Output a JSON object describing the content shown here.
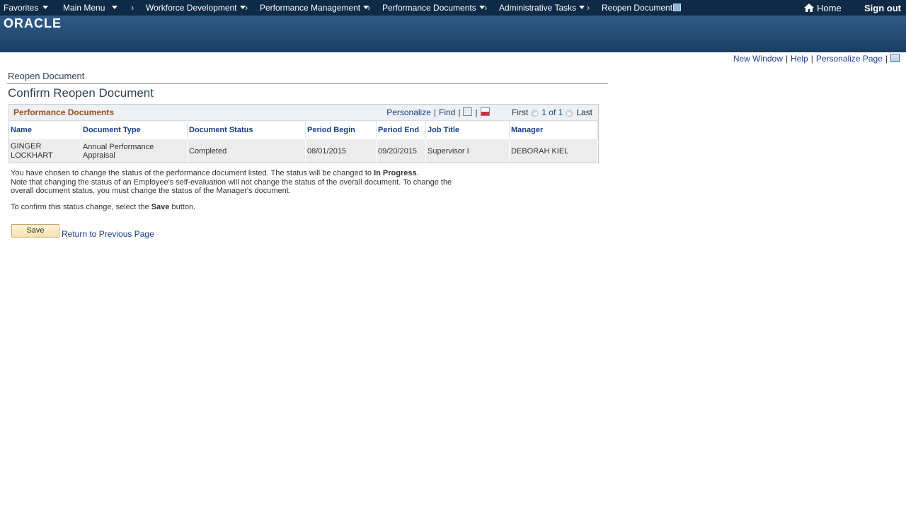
{
  "nav": {
    "items": [
      "Favorites",
      "Main Menu",
      "Workforce Development",
      "Performance Management",
      "Performance Documents",
      "Administrative Tasks",
      "Reopen Document"
    ],
    "home": "Home",
    "signout": "Sign out"
  },
  "brand": {
    "logo": "ORACLE"
  },
  "page_links": {
    "new_window": "New Window",
    "help": "Help",
    "personalize_page": "Personalize Page"
  },
  "breadcrumb": "Reopen Document",
  "page_title": "Confirm Reopen Document",
  "grid": {
    "title": "Performance Documents",
    "personalize": "Personalize",
    "find": "Find",
    "first": "First",
    "page_info": "1 of 1",
    "last": "Last",
    "columns": [
      "Name",
      "Document Type",
      "Document Status",
      "Period Begin",
      "Period End",
      "Job Title",
      "Manager"
    ],
    "rows": [
      {
        "name": "GINGER LOCKHART",
        "document_type": "Annual Performance Appraisal",
        "document_status": "Completed",
        "period_begin": "08/01/2015",
        "period_end": "09/20/2015",
        "job_title": "Supervisor I",
        "manager": "DEBORAH KIEL"
      }
    ]
  },
  "message": {
    "line1_prefix": "You have chosen to change the status of the performance document listed. The status will be changed to ",
    "line1_bold": "In Progress",
    "line1_suffix": ".",
    "line2": "Note that changing the status of an Employee's self-evaluation will not change the status of the overall document. To change the overall document status, you must change the status of the Manager's document.",
    "confirm_prefix": "To confirm this status change, select the ",
    "confirm_bold": "Save",
    "confirm_suffix": " button."
  },
  "actions": {
    "save": "Save",
    "return": "Return to Previous Page"
  }
}
